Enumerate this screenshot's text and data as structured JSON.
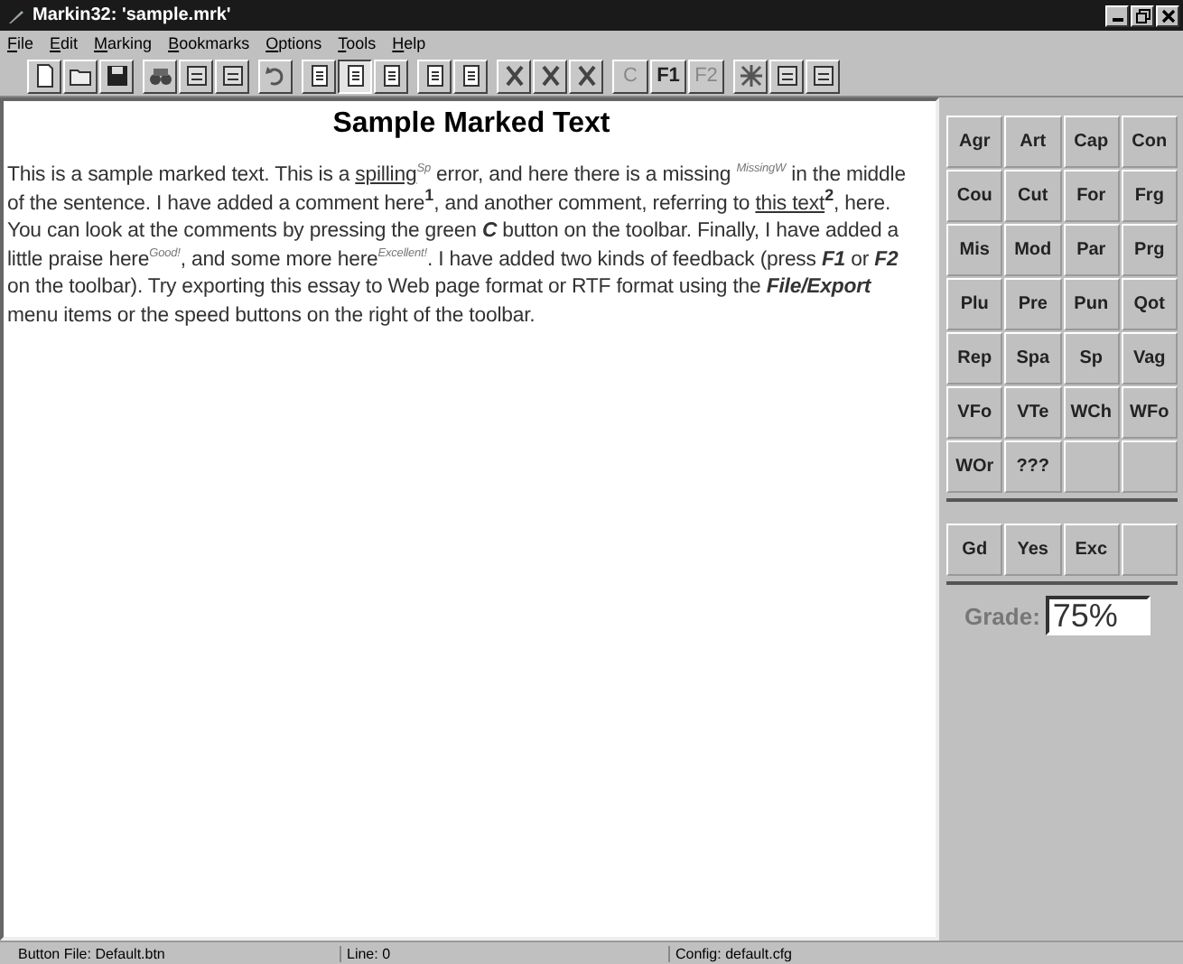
{
  "window": {
    "title": "Markin32: 'sample.mrk'"
  },
  "menu": [
    "File",
    "Edit",
    "Marking",
    "Bookmarks",
    "Options",
    "Tools",
    "Help"
  ],
  "toolbar": [
    {
      "kind": "icon",
      "pressed": false
    },
    {
      "kind": "icon",
      "pressed": false
    },
    {
      "kind": "icon",
      "pressed": false
    },
    {
      "kind": "icon",
      "pressed": false
    },
    {
      "kind": "icon",
      "pressed": false
    },
    {
      "kind": "icon",
      "pressed": false
    },
    {
      "kind": "icon",
      "pressed": false
    },
    {
      "kind": "icon",
      "pressed": false
    },
    {
      "kind": "icon",
      "pressed": true
    },
    {
      "kind": "icon",
      "pressed": false
    },
    {
      "kind": "icon",
      "pressed": false
    },
    {
      "kind": "icon",
      "pressed": false
    },
    {
      "kind": "icon",
      "pressed": false
    },
    {
      "kind": "icon",
      "pressed": false
    },
    {
      "kind": "icon",
      "pressed": false
    },
    {
      "kind": "text",
      "label": "C",
      "disabled": true,
      "pressed": false
    },
    {
      "kind": "text",
      "label": "F1",
      "disabled": false,
      "pressed": false
    },
    {
      "kind": "text",
      "label": "F2",
      "disabled": true,
      "pressed": false
    },
    {
      "kind": "icon",
      "pressed": false
    },
    {
      "kind": "icon",
      "pressed": false
    },
    {
      "kind": "icon",
      "pressed": false
    }
  ],
  "document": {
    "heading": "Sample Marked Text",
    "paragraph": [
      {
        "kind": "plain",
        "text": "This is a sample marked text. This is a "
      },
      {
        "kind": "underline",
        "text": "spilling"
      },
      {
        "kind": "tag",
        "text": "Sp"
      },
      {
        "kind": "plain",
        "text": " error, and here there is a missing "
      },
      {
        "kind": "tag",
        "text": "MissingW"
      },
      {
        "kind": "plain",
        "text": " in the middle of the sentence. I have added a comment here"
      },
      {
        "kind": "note",
        "text": "1"
      },
      {
        "kind": "plain",
        "text": ", and another comment, referring to "
      },
      {
        "kind": "underline",
        "text": "this text"
      },
      {
        "kind": "note",
        "text": "2"
      },
      {
        "kind": "plain",
        "text": ", here. You can look at the comments by pressing the green "
      },
      {
        "kind": "emph",
        "text": "C"
      },
      {
        "kind": "plain",
        "text": " button on the toolbar. Finally, I have added a little praise here"
      },
      {
        "kind": "tag",
        "text": "Good!"
      },
      {
        "kind": "plain",
        "text": ", and some more here"
      },
      {
        "kind": "tag",
        "text": "Excellent!"
      },
      {
        "kind": "plain",
        "text": ". I have added two kinds of feedback (press "
      },
      {
        "kind": "emph",
        "text": "F1"
      },
      {
        "kind": "plain",
        "text": " or "
      },
      {
        "kind": "emph",
        "text": "F2"
      },
      {
        "kind": "plain",
        "text": " on the toolbar). Try exporting this essay to Web page format or RTF format using the "
      },
      {
        "kind": "emph",
        "text": "File/Export"
      },
      {
        "kind": "plain",
        "text": " menu items or the speed buttons on the right of the toolbar."
      }
    ]
  },
  "mark_buttons": [
    "Agr",
    "Art",
    "Cap",
    "Con",
    "Cou",
    "Cut",
    "For",
    "Frg",
    "Mis",
    "Mod",
    "Par",
    "Prg",
    "Plu",
    "Pre",
    "Pun",
    "Qot",
    "Rep",
    "Spa",
    "Sp",
    "Vag",
    "VFo",
    "VTe",
    "WCh",
    "WFo",
    "WOr",
    "???"
  ],
  "praise_buttons": [
    "Gd",
    "Yes",
    "Exc"
  ],
  "grade": {
    "label": "Grade:",
    "value": "75%"
  },
  "status_bar": [
    "Button File: Default.btn",
    "Line: 0",
    "Config: default.cfg"
  ]
}
